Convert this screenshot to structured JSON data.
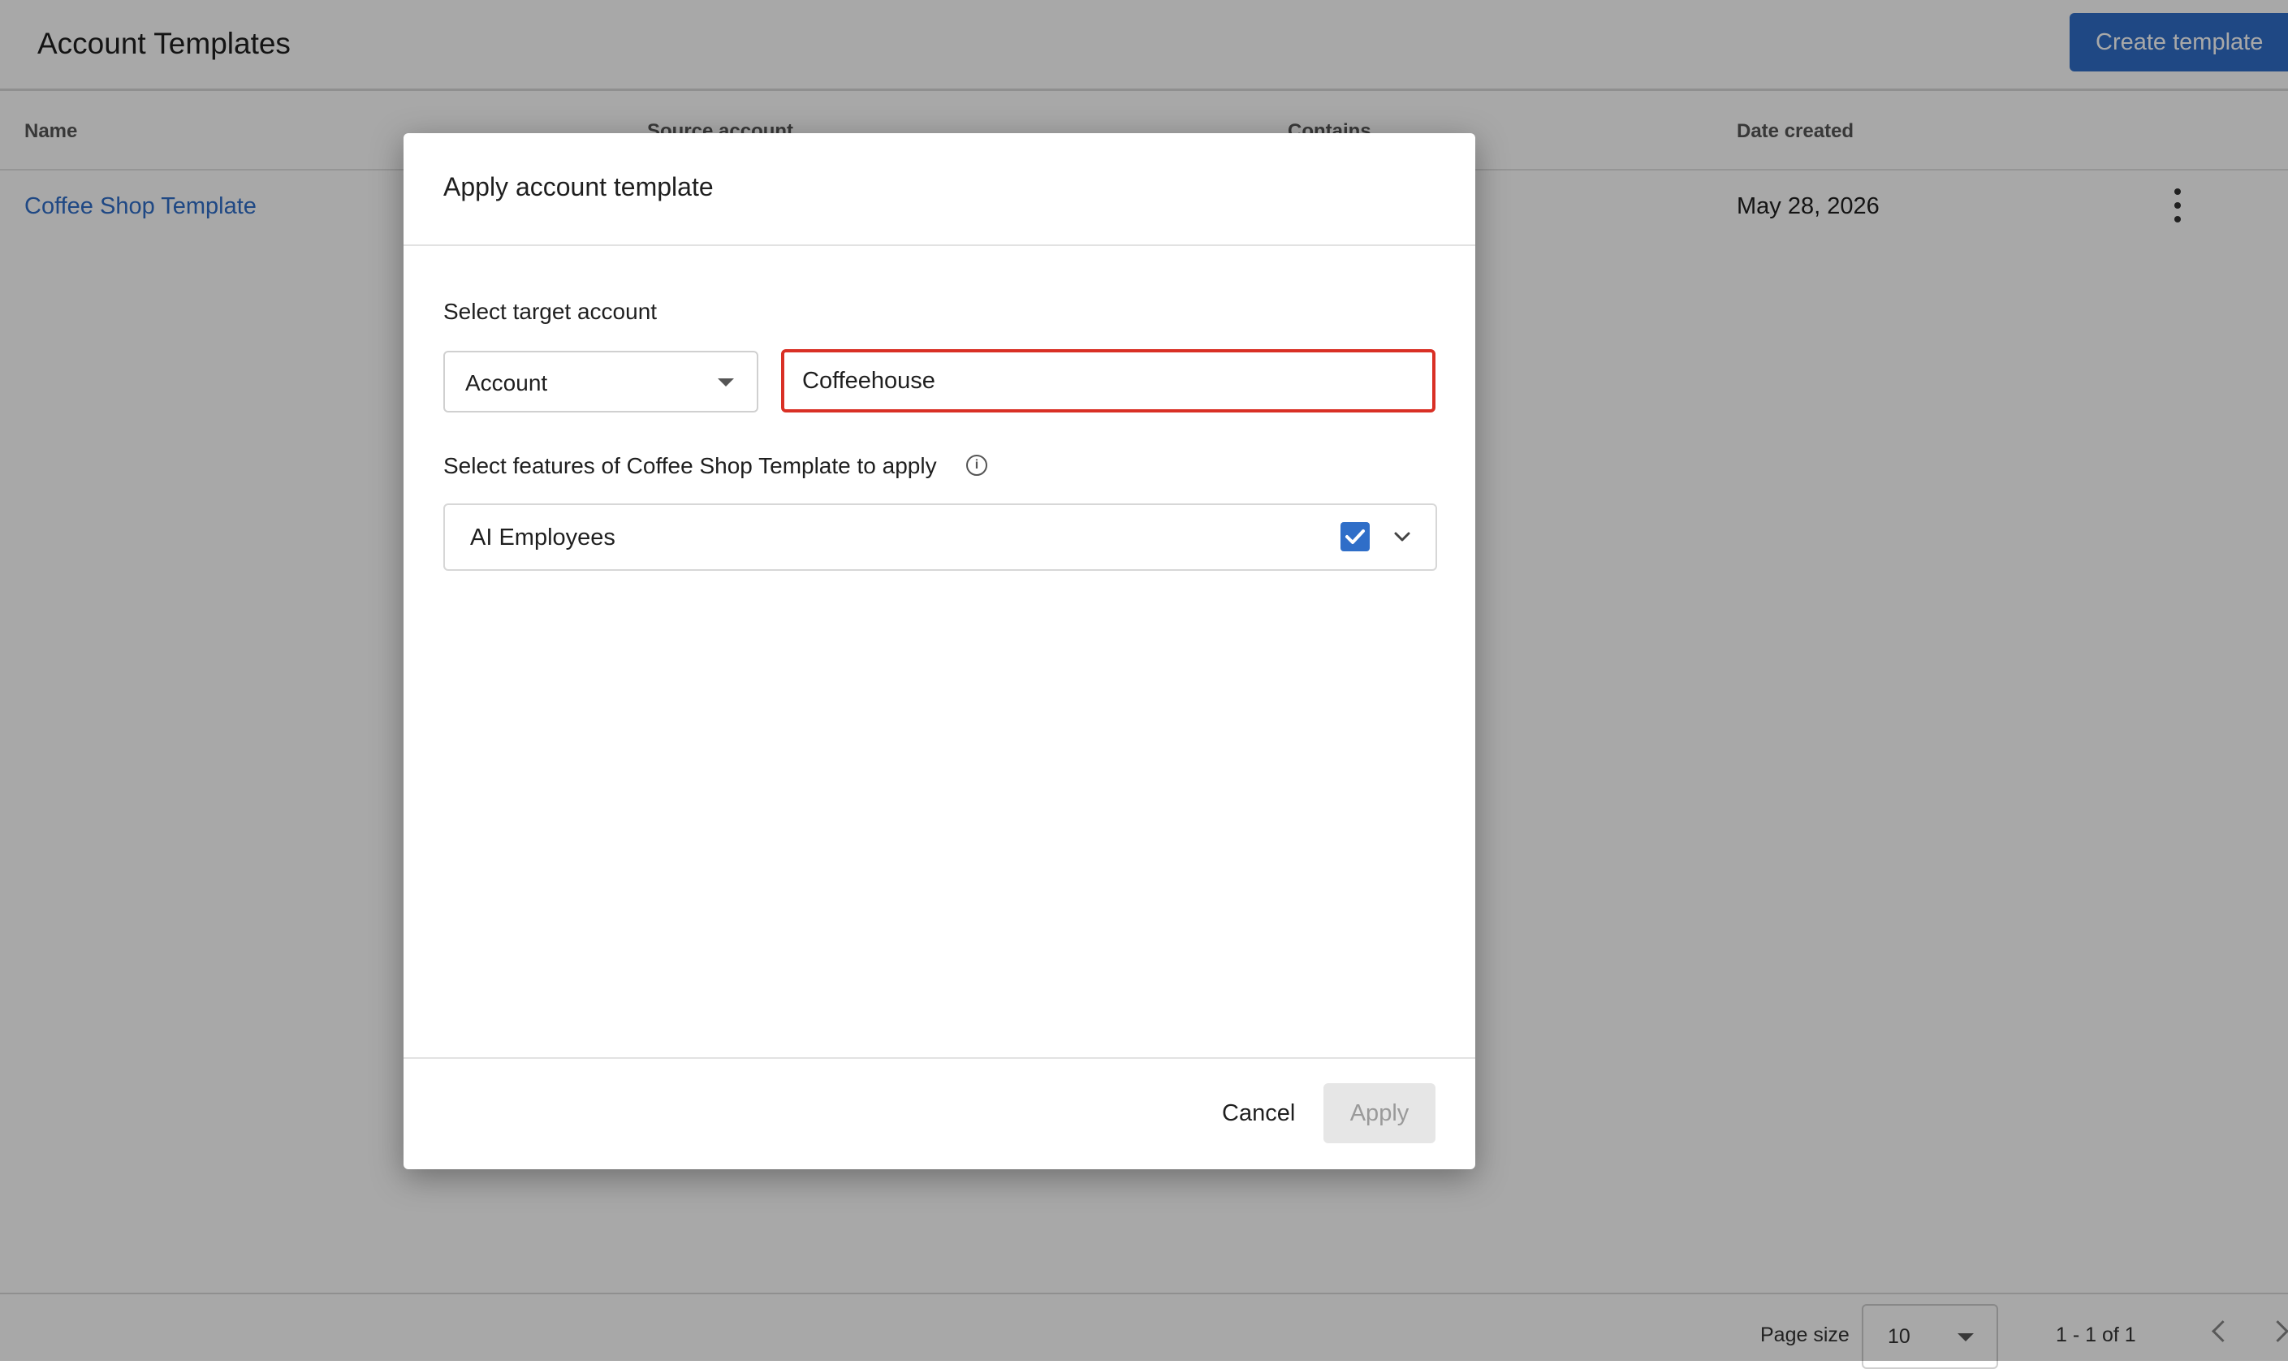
{
  "page": {
    "title": "Account Templates",
    "create_button_label": "Create template"
  },
  "table": {
    "columns": [
      "Name",
      "Source account",
      "Contains",
      "Date created"
    ],
    "rows": [
      {
        "name": "Coffee Shop Template",
        "date_created": "May 28, 2026"
      }
    ]
  },
  "pagination": {
    "page_size_label": "Page size",
    "page_size_value": "10",
    "range_text": "1 - 1 of 1"
  },
  "dialog": {
    "title": "Apply account template",
    "target_label": "Select target account",
    "account_type_value": "Account",
    "account_search_value": "Coffeehouse",
    "features_label": "Select features of Coffee Shop Template to apply",
    "features": [
      {
        "label": "AI Employees",
        "checked": true
      }
    ],
    "cancel_label": "Cancel",
    "apply_label": "Apply"
  },
  "colors": {
    "accent": "#2f6ec8",
    "error_border": "#d93025",
    "disabled_button": "#e6e6e6"
  }
}
